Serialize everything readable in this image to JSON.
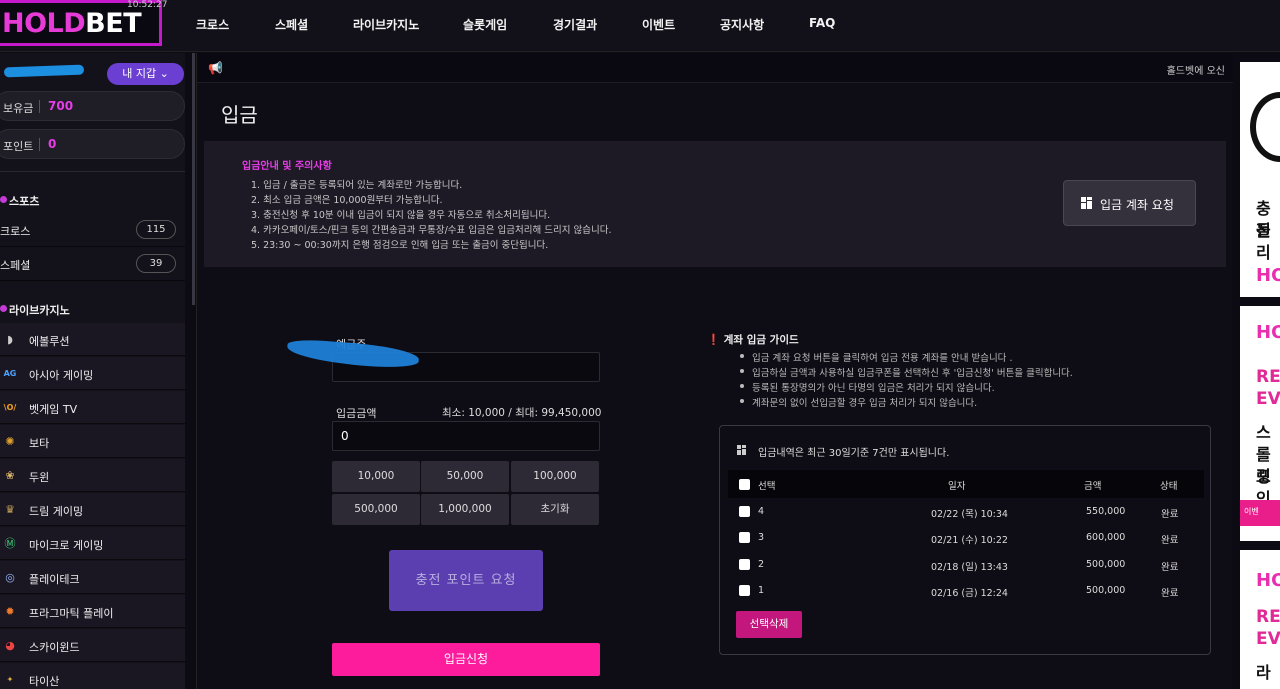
{
  "header": {
    "logo_part1": "HOLD",
    "logo_part2": "BET",
    "clock": "10:52:27",
    "nav": [
      "크로스",
      "스페셜",
      "라이브카지노",
      "슬롯게임",
      "경기결과",
      "이벤트",
      "공지사항",
      "FAQ"
    ]
  },
  "sidebar": {
    "wallet_button": "내 지갑",
    "balance_label": "보유금",
    "balance_value": "700",
    "points_label": "포인트",
    "points_value": "0",
    "sports_title": "스포츠",
    "sports_items": [
      {
        "label": "크로스",
        "count": "115"
      },
      {
        "label": "스페셜",
        "count": "39"
      }
    ],
    "casino_title": "라이브카지노",
    "casino_items": [
      {
        "label": "에볼루션",
        "icon": "evolution-icon"
      },
      {
        "label": "아시아 게이밍",
        "icon": "ag-icon"
      },
      {
        "label": "벳게임 TV",
        "icon": "betgames-icon"
      },
      {
        "label": "보타",
        "icon": "bota-icon"
      },
      {
        "label": "두윈",
        "icon": "dowin-icon"
      },
      {
        "label": "드림 게이밍",
        "icon": "dream-gaming-icon"
      },
      {
        "label": "마이크로 게이밍",
        "icon": "microgaming-icon"
      },
      {
        "label": "플레이테크",
        "icon": "playtech-icon"
      },
      {
        "label": "프라그마틱 플레이",
        "icon": "pragmatic-icon"
      },
      {
        "label": "스카이윈드",
        "icon": "skywind-icon"
      },
      {
        "label": "타이산",
        "icon": "taishan-icon"
      }
    ]
  },
  "main": {
    "notice_marquee": "홀드벳에 오신",
    "page_title": "입금",
    "info": {
      "title": "입금안내 및 주의사항",
      "lines": [
        "1. 입금 / 출금은 등록되어 있는 계좌로만 가능합니다.",
        "2. 최소 입금 금액은 10,000원부터 가능합니다.",
        "3. 충전신청 후 10분 이내 입금이 되지 않을 경우 자동으로 취소처리됩니다.",
        "4. 카카오페이/토스/핀크 등의 간편송금과 무통장/수표 입금은 입금처리해 드리지 않습니다.",
        "5. 23:30 ~ 00:30까지 은행 점검으로 인해 입금 또는 출금이 중단됩니다."
      ],
      "account_button": "입금 계좌 요청"
    },
    "form": {
      "depositor_label": "예금주",
      "amount_label": "입금금액",
      "limits": "최소: 10,000 / 최대: 99,450,000",
      "amount_value": "0",
      "quick_amounts": [
        "10,000",
        "50,000",
        "100,000",
        "500,000",
        "1,000,000",
        "초기화"
      ],
      "charge_button": "충전 포인트 요청",
      "submit_button": "입금신청"
    },
    "guide": {
      "title": "계좌 입금 가이드",
      "lines": [
        "입금 계좌 요청 버튼을 클릭하여 입금 전용 계좌를 안내 받습니다 .",
        "입금하실 금액과 사용하실 입금쿠폰을 선택하신 후 '입금신청' 버튼을 클릭합니다.",
        "등록된 통장명의가 아닌 타명의 입금은 처리가 되지 않습니다.",
        "계좌문의 없이 선입금할 경우 입금 처리가 되지 않습니다."
      ]
    },
    "history": {
      "title": "입금내역은 최근 30일기준 7건만 표시됩니다.",
      "columns": [
        "선택",
        "일자",
        "금액",
        "상태"
      ],
      "rows": [
        {
          "no": "4",
          "date": "02/22 (목) 10:34",
          "amount": "550,000",
          "status": "완료"
        },
        {
          "no": "3",
          "date": "02/21 (수) 10:22",
          "amount": "600,000",
          "status": "완료"
        },
        {
          "no": "2",
          "date": "02/18 (일) 13:43",
          "amount": "500,000",
          "status": "완료"
        },
        {
          "no": "1",
          "date": "02/16 (금) 12:24",
          "amount": "500,000",
          "status": "완료"
        }
      ],
      "delete_button": "선택삭제"
    }
  },
  "banner": {
    "b1_line1": "충전",
    "b1_line2": "돌리",
    "logo": "HO",
    "b2_pink1": "RE",
    "b2_pink2": "EV",
    "b2_dark1": "스",
    "b2_dark2": "롤링",
    "b2_dark3": "포인",
    "b2_foot": "이벤",
    "b3_pink1": "RE",
    "b3_pink2": "EV",
    "b3_dark1": "라"
  }
}
